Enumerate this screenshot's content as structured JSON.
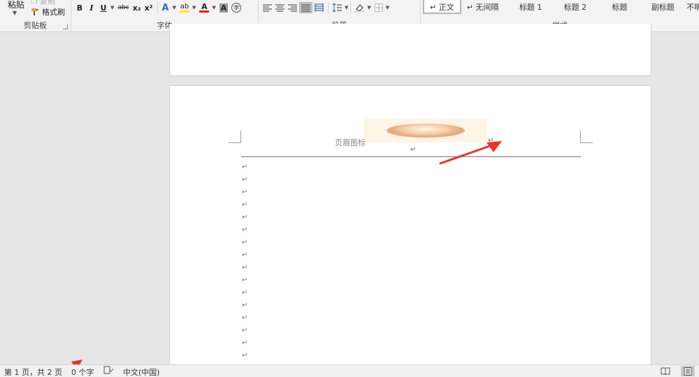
{
  "ribbon": {
    "clipboard": {
      "label": "剪贴板",
      "paste_label": "粘贴",
      "copy_label": "复制",
      "format_painter_label": "格式刷"
    },
    "font": {
      "label": "字体",
      "bold": "B",
      "italic": "I",
      "underline": "U",
      "strikethrough": "abc",
      "subscript": "x₂",
      "superscript": "x²",
      "text_effects": "A",
      "highlight": "ab",
      "font_color": "A",
      "char_shading": "A",
      "enclose_char": "字"
    },
    "paragraph": {
      "label": "段落"
    },
    "styles": {
      "label": "样式",
      "items": [
        "↵ 正文",
        "↵ 无间隔",
        "标题 1",
        "标题 2",
        "标题",
        "副标题",
        "不明"
      ]
    }
  },
  "document": {
    "header_text": "页眉图标",
    "return_mark": "↵",
    "paragraph_marks": [
      "↵",
      "↵",
      "↵",
      "↵",
      "↵",
      "↵",
      "↵",
      "↵",
      "↵",
      "↵",
      "↵",
      "↵",
      "↵",
      "↵",
      "↵",
      "↵",
      "↵"
    ]
  },
  "statusbar": {
    "page_info": "第 1 页，共 2 页",
    "word_count": "0 个字",
    "language": "中文(中国)"
  },
  "colors": {
    "annotation_arrow": "#e8342a",
    "highlight_yellow": "#ffe600",
    "font_red": "#e02020"
  }
}
